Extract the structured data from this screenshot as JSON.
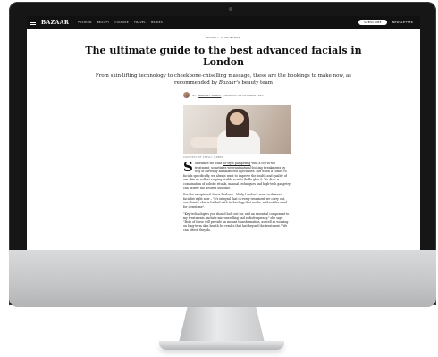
{
  "site": {
    "logo": "BAZAAR",
    "nav_links": [
      "FASHION",
      "BEAUTY",
      "CULTURE",
      "TRAVEL",
      "BRIDES"
    ],
    "subscribe_label": "SUBSCRIBE",
    "newsletter_label": "NEWSLETTER"
  },
  "article": {
    "breadcrumb": "BEAUTY > SKINCARE",
    "headline": "The ultimate guide to the best advanced facials in London",
    "standfirst_pre": "From skin-lifting technology to cheekbone-chiselling massage, these are the bookings to make now, as recommended by ",
    "standfirst_em": "Bazaar",
    "standfirst_post": "'s beauty team",
    "byline_prefix": "BY",
    "author": "BRIDGET MARCH",
    "updated": "UPDATED: 04 OCTOBER 2023",
    "caption": "COURTESY OF SHELLY JENNER",
    "dropcap": "S",
    "p1_a": "ometimes we want ",
    "p1_link1": "no-style pampering",
    "p1_b": " with a top-to-toe treatment; sometimes we want ",
    "p1_link2": "natural-looking tweakments",
    "p1_c": " by way of carefully administered injectables. But when it comes to facials specifically, we always want to improve the health and quality of our skin as well as reaping visible results (hello glow!). We dive, a combination of holistic rituals, manual techniques and high-tech gadgetry can deliver the desired outcome.",
    "p2": "For the exceptional Sonia Barlowe – likely London's most in-demand facialist right now – \"it's integral that in every treatment we carry out, our client's skin is bathed with technology that works, without the need for downtime\".",
    "p3_a": "\"Key technologies you should look out for, and an essential component to my treatments, include ",
    "p3_link1": "microneedling",
    "p3_b": " and ",
    "p3_link2": "radiofrequency",
    "p3_c": ",\" she says. \"Both of these will provide an instant transformation, as well as working on long-term skin health for results that last beyond the treatment.\" We can attest, they do."
  }
}
